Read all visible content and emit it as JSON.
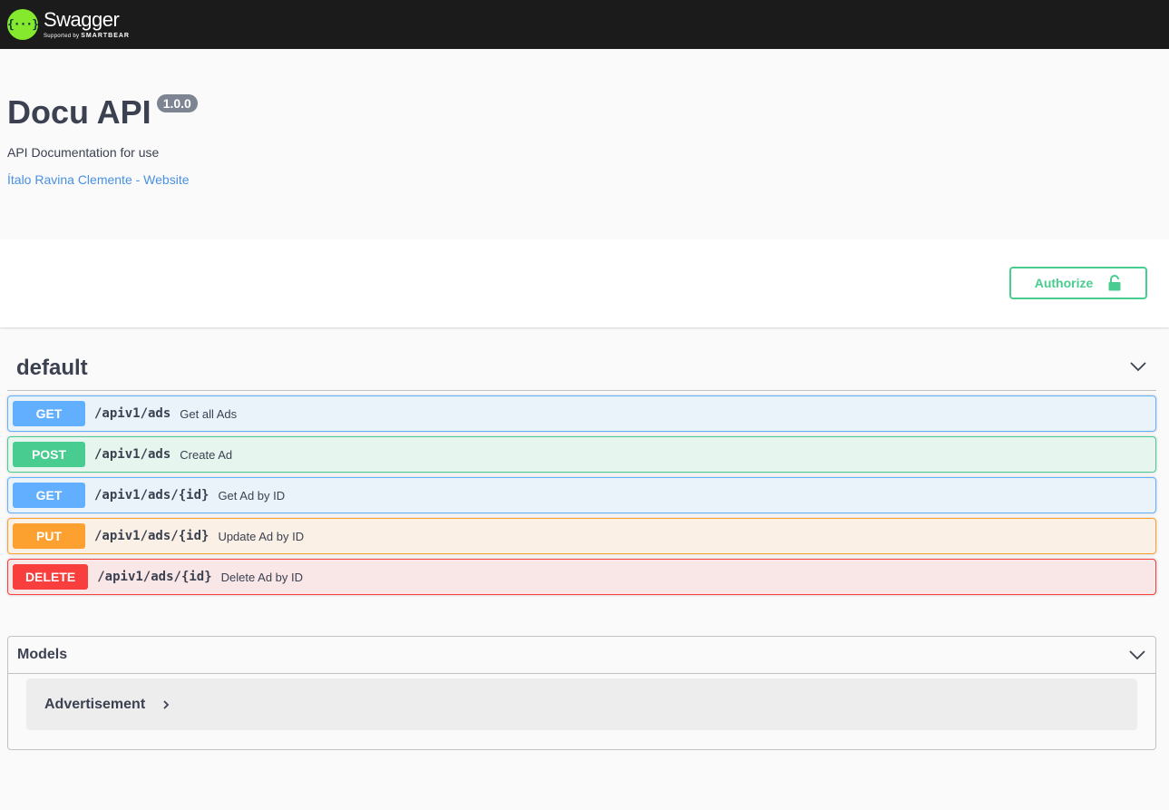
{
  "topbar": {
    "logo_mark": "{···}",
    "logo_title": "Swagger",
    "logo_sub_prefix": "Supported by ",
    "logo_sub_brand": "SMARTBEAR"
  },
  "info": {
    "title": "Docu API",
    "version": "1.0.0",
    "description": "API Documentation for use",
    "contact_link": "Ítalo Ravina Clemente - Website"
  },
  "scheme": {
    "authorize_label": "Authorize",
    "lock_icon": "lock-icon"
  },
  "tag": {
    "name": "default",
    "chevron_icon": "chevron-down-icon"
  },
  "operations": [
    {
      "method": "GET",
      "path": "/apiv1/ads",
      "summary": "Get all Ads"
    },
    {
      "method": "POST",
      "path": "/apiv1/ads",
      "summary": "Create Ad"
    },
    {
      "method": "GET",
      "path": "/apiv1/ads/{id}",
      "summary": "Get Ad by ID"
    },
    {
      "method": "PUT",
      "path": "/apiv1/ads/{id}",
      "summary": "Update Ad by ID"
    },
    {
      "method": "DELETE",
      "path": "/apiv1/ads/{id}",
      "summary": "Delete Ad by ID"
    }
  ],
  "models": {
    "title": "Models",
    "items": [
      {
        "name": "Advertisement"
      }
    ]
  },
  "colors": {
    "get": "#61affe",
    "post": "#49cc90",
    "put": "#fca130",
    "delete": "#f93e3e",
    "topbar": "#1b1b1b",
    "logo": "#85ea2d",
    "link": "#4990e2"
  }
}
